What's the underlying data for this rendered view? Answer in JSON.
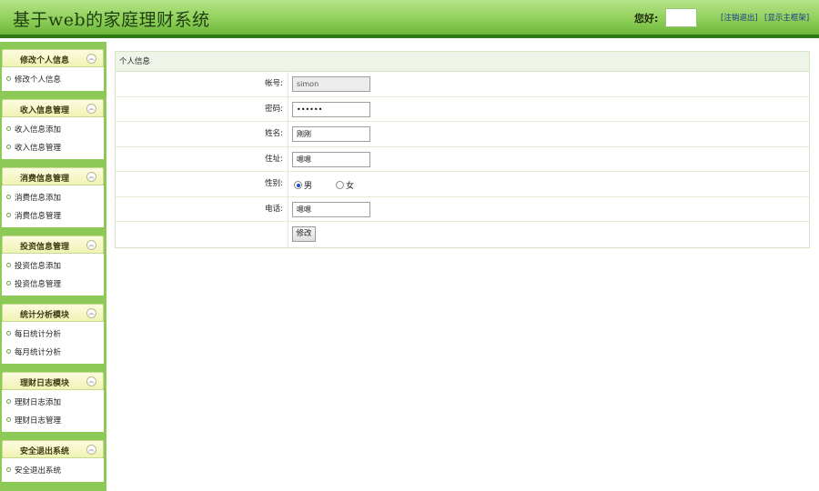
{
  "header": {
    "title": "基于web的家庭理财系统",
    "greeting": "您好:",
    "username": "",
    "logout_link": "[注销退出]",
    "main_frame_link": "[显示主框架]"
  },
  "sidebar": {
    "groups": [
      {
        "title": "修改个人信息",
        "toggle_icon": "collapse-icon",
        "items": [
          "修改个人信息"
        ]
      },
      {
        "title": "收入信息管理",
        "toggle_icon": "collapse-icon",
        "items": [
          "收入信息添加",
          "收入信息管理"
        ]
      },
      {
        "title": "消费信息管理",
        "toggle_icon": "collapse-icon",
        "items": [
          "消费信息添加",
          "消费信息管理"
        ]
      },
      {
        "title": "投资信息管理",
        "toggle_icon": "collapse-icon",
        "items": [
          "投资信息添加",
          "投资信息管理"
        ]
      },
      {
        "title": "统计分析模块",
        "toggle_icon": "collapse-icon",
        "items": [
          "每日统计分析",
          "每月统计分析"
        ]
      },
      {
        "title": "理财日志模块",
        "toggle_icon": "collapse-icon",
        "items": [
          "理财日志添加",
          "理财日志管理"
        ]
      },
      {
        "title": "安全退出系统",
        "toggle_icon": "collapse-icon",
        "items": [
          "安全退出系统"
        ]
      }
    ]
  },
  "main": {
    "panel_title": "个人信息",
    "form": {
      "account_label": "帐号:",
      "account_value": "simon",
      "password_label": "密码:",
      "password_value": "••••••",
      "name_label": "姓名:",
      "name_value": "刚刚",
      "address_label": "住址:",
      "address_value": "嗯嗯",
      "gender_label": "性别:",
      "gender_options": [
        "男",
        "女"
      ],
      "gender_selected": "男",
      "phone_label": "电话:",
      "phone_value": "嗯嗯",
      "submit_label": "修改"
    }
  },
  "colors": {
    "header_green": "#8fd05a",
    "header_border": "#2f7a14",
    "sidebar_green": "#8cc957",
    "menu_head_bg": "#f0f3b3",
    "panel_border": "#d4e3c4"
  }
}
